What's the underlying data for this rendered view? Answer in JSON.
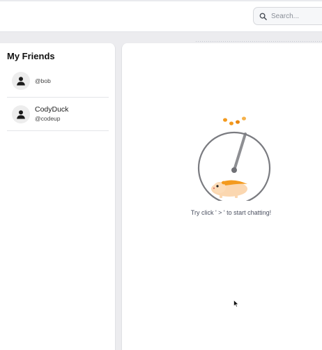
{
  "header": {
    "search": {
      "placeholder": "Search...",
      "value": "",
      "icon": "search-icon"
    }
  },
  "sidebar": {
    "title": "My Friends",
    "friends": [
      {
        "name": "",
        "handle": "@bob",
        "icon": "user-icon"
      },
      {
        "name": "CodyDuck",
        "handle": "@codeup",
        "icon": "user-icon"
      }
    ]
  },
  "main": {
    "hint": "Try click ' > ' to start chatting!",
    "illustration": "hamster-wheel-icon"
  },
  "colors": {
    "accent": "#f39a1e",
    "background": "#ececef",
    "panel": "#ffffff"
  }
}
